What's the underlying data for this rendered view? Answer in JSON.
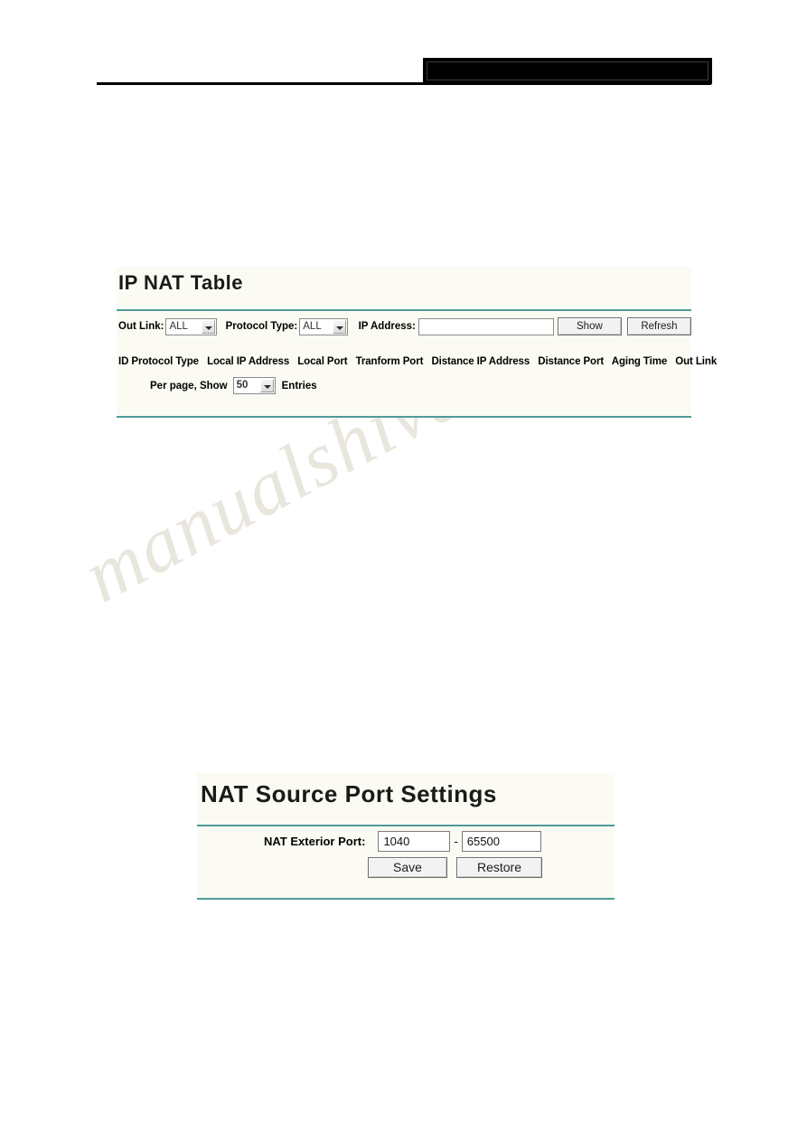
{
  "page": {
    "watermark": "manualshive.com"
  },
  "nat_table": {
    "title": "IP NAT Table",
    "filters": {
      "out_link_label": "Out Link:",
      "out_link_value": "ALL",
      "protocol_type_label": "Protocol Type:",
      "protocol_type_value": "ALL",
      "ip_address_label": "IP Address:",
      "ip_address_value": "",
      "show_button": "Show",
      "refresh_button": "Refresh"
    },
    "columns": [
      "ID",
      "Protocol Type",
      "Local IP Address",
      "Local Port",
      "Tranform Port",
      "Distance IP Address",
      "Distance Port",
      "Aging Time",
      "Out Link"
    ],
    "per_page": {
      "prefix": "Per page, Show",
      "value": "50",
      "suffix": "Entries"
    }
  },
  "nat_source_port": {
    "title": "NAT Source Port Settings",
    "exterior_port_label": "NAT Exterior Port:",
    "port_start": "1040",
    "port_separator": "-",
    "port_end": "65500",
    "save_button": "Save",
    "restore_button": "Restore"
  }
}
